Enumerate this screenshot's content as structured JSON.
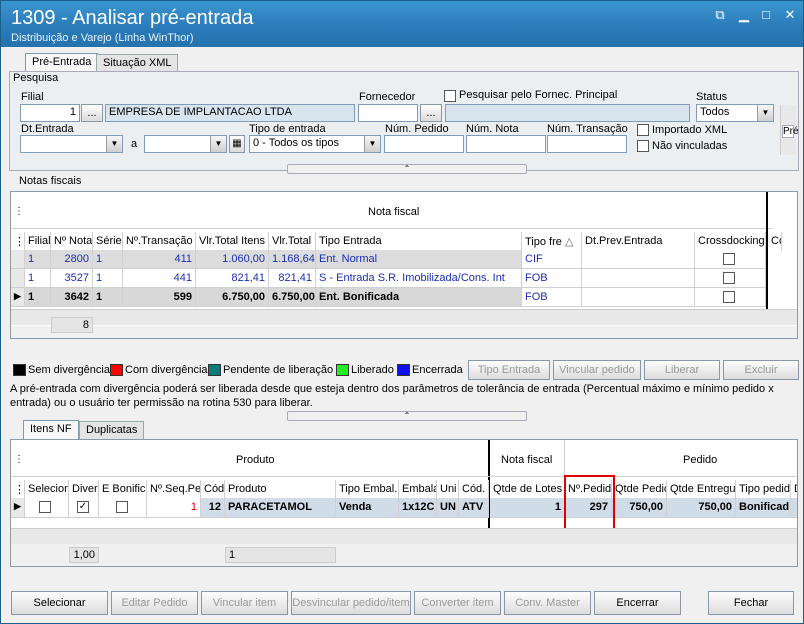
{
  "window": {
    "title": "1309 - Analisar pré-entrada",
    "subtitle": "Distribuição e Varejo (Linha WinThor)"
  },
  "top_tabs": [
    {
      "label": "Pré-Entrada"
    },
    {
      "label": "Situação XML"
    }
  ],
  "pesquisa": {
    "group_label": "Pesquisa",
    "filial_label": "Filial",
    "filial_value": "1",
    "filial_btn": "...",
    "filial_name": "EMPRESA DE IMPLANTACAO LTDA",
    "fornecedor_label": "Fornecedor",
    "fornecedor_btn": "...",
    "pesq_fornec_label": "Pesquisar pelo Fornec. Principal",
    "status_label": "Status",
    "status_value": "Todos",
    "dtentrada_label": "Dt.Entrada",
    "a_label": "a",
    "tipo_entrada_label": "Tipo de entrada",
    "tipo_entrada_value": "0 - Todos os tipos",
    "num_pedido_label": "Núm. Pedido",
    "num_nota_label": "Núm. Nota",
    "num_transacao_label": "Núm. Transação",
    "importado_xml_label": "Importado XML",
    "nao_vinculadas_label": "Não vinculadas",
    "side_tab": "Pré"
  },
  "notas": {
    "group_label": "Notas fiscais",
    "band_label": "Nota fiscal",
    "columns": [
      "Filial",
      "Nº Nota",
      "Série",
      "Nº.Transação",
      "Vlr.Total Itens",
      "Vlr.Total",
      "Tipo Entrada",
      "Tipo fre",
      "Dt.Prev.Entrada",
      "Crossdocking",
      "Co"
    ],
    "rows": [
      {
        "filial": "1",
        "nota": "2800",
        "serie": "1",
        "transacao": "411",
        "vlr_itens": "1.060,00",
        "vlr_total": "1.168,64",
        "tipo": "Ent. Normal",
        "frete": "CIF"
      },
      {
        "filial": "1",
        "nota": "3527",
        "serie": "1",
        "transacao": "441",
        "vlr_itens": "821,41",
        "vlr_total": "821,41",
        "tipo": "S - Entrada S.R. Imobilizada/Cons. Int",
        "frete": "FOB"
      },
      {
        "filial": "1",
        "nota": "3642",
        "serie": "1",
        "transacao": "599",
        "vlr_itens": "6.750,00",
        "vlr_total": "6.750,00",
        "tipo": "Ent. Bonificada",
        "frete": "FOB"
      }
    ],
    "footer_count": "8"
  },
  "legend": [
    {
      "label": "Sem divergência",
      "color": "#000000"
    },
    {
      "label": "Com divergência",
      "color": "#ff0000"
    },
    {
      "label": "Pendente de liberação",
      "color": "#0a7a7a"
    },
    {
      "label": "Liberado",
      "color": "#22ee22"
    },
    {
      "label": "Encerrada",
      "color": "#1010ee"
    }
  ],
  "actions": {
    "tipo_entrada": "Tipo Entrada",
    "vincular_pedido": "Vincular pedido",
    "liberar": "Liberar",
    "excluir": "Excluir"
  },
  "info_text": "A pré-entrada com divergência poderá ser liberada desde que esteja dentro dos parâmetros de tolerância de entrada (Percentual máximo e mínimo pedido x entrada) ou o usuário ter permissão na rotina 530 para liberar.",
  "item_tabs": [
    {
      "label": "Itens NF"
    },
    {
      "label": "Duplicatas"
    }
  ],
  "itens": {
    "band_produto": "Produto",
    "band_nota": "Nota fiscal",
    "band_pedido": "Pedido",
    "columns": [
      "Seleciona",
      "Diver",
      "E Bonifica",
      "Nº.Seq.Pe",
      "Cód",
      "Produto",
      "Tipo Embal.P",
      "Embala",
      "Uni",
      "Cód.",
      "Qtde de Lotes",
      "Nº.Pedid",
      "Qtde Pedic",
      "Qtde Entregu",
      "Tipo pedid",
      "D"
    ],
    "row": {
      "seq": "1",
      "cod": "12",
      "produto": "PARACETAMOL",
      "tipo_embal": "Venda",
      "embala": "1x12C",
      "uni": "UN",
      "cod2": "ATV",
      "lotes": "1",
      "pedido": "297",
      "qtde_pedida": "750,00",
      "qtde_entregue": "750,00",
      "tipo_pedido": "Bonificad"
    },
    "footer_a": "1,00",
    "footer_b": "1"
  },
  "bottom_buttons": [
    "Selecionar",
    "Editar Pedido",
    "Vincular item",
    "Desvincular pedido/item",
    "Converter item",
    "Conv. Master",
    "Encerrar",
    "Fechar"
  ]
}
